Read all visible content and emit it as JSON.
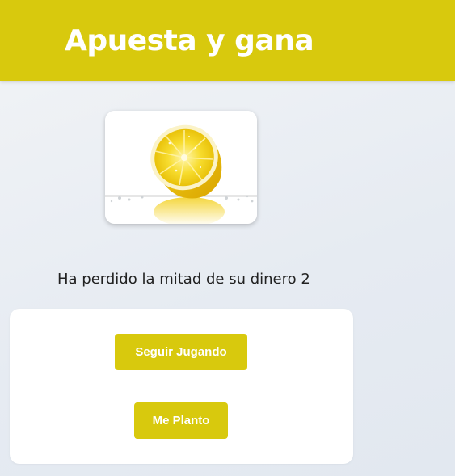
{
  "header": {
    "title": "Apuesta y gana",
    "background_color": "#d8c90d"
  },
  "image": {
    "icon": "lemon-half-icon"
  },
  "result": {
    "message": "Ha perdido la mitad de su dinero 2"
  },
  "actions": {
    "continue_label": "Seguir Jugando",
    "stop_label": "Me Planto",
    "button_color": "#d8c90d"
  }
}
